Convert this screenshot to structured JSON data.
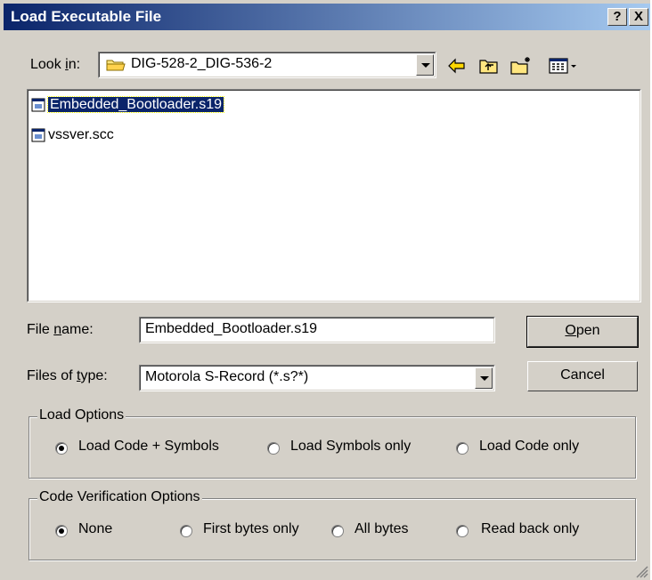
{
  "window": {
    "title": "Load Executable File",
    "help_glyph": "?",
    "close_glyph": "X"
  },
  "lookin": {
    "label_pre": "Look ",
    "label_u": "i",
    "label_post": "n:",
    "value": "DIG-528-2_DIG-536-2"
  },
  "files": [
    {
      "name": "Embedded_Bootloader.s19",
      "selected": true
    },
    {
      "name": "vssver.scc",
      "selected": false
    }
  ],
  "filename": {
    "label_pre": "File ",
    "label_u": "n",
    "label_post": "ame:",
    "value": "Embedded_Bootloader.s19"
  },
  "filetype": {
    "label_pre": "Files of ",
    "label_u": "t",
    "label_post": "ype:",
    "value": "Motorola S-Record (*.s?*)"
  },
  "buttons": {
    "open_u": "O",
    "open_rest": "pen",
    "cancel": "Cancel"
  },
  "load_options": {
    "title": "Load Options",
    "items": [
      "Load Code + Symbols",
      "Load Symbols only",
      "Load Code only"
    ],
    "selected": 0
  },
  "verification": {
    "title": "Code Verification Options",
    "items": [
      "None",
      "First bytes only",
      "All bytes",
      "Read back only"
    ],
    "selected": 0
  },
  "icons": {
    "lookin": "folder-icon",
    "back": "back-arrow-icon",
    "up": "up-folder-icon",
    "newfolder": "new-folder-icon",
    "view": "view-menu-icon",
    "file_s19": "s19-file-icon",
    "file_scc": "scc-file-icon"
  },
  "colors": {
    "title_start": "#0a246a",
    "title_end": "#a6caf0",
    "selection": "#0a246a",
    "face": "#d4d0c8"
  }
}
